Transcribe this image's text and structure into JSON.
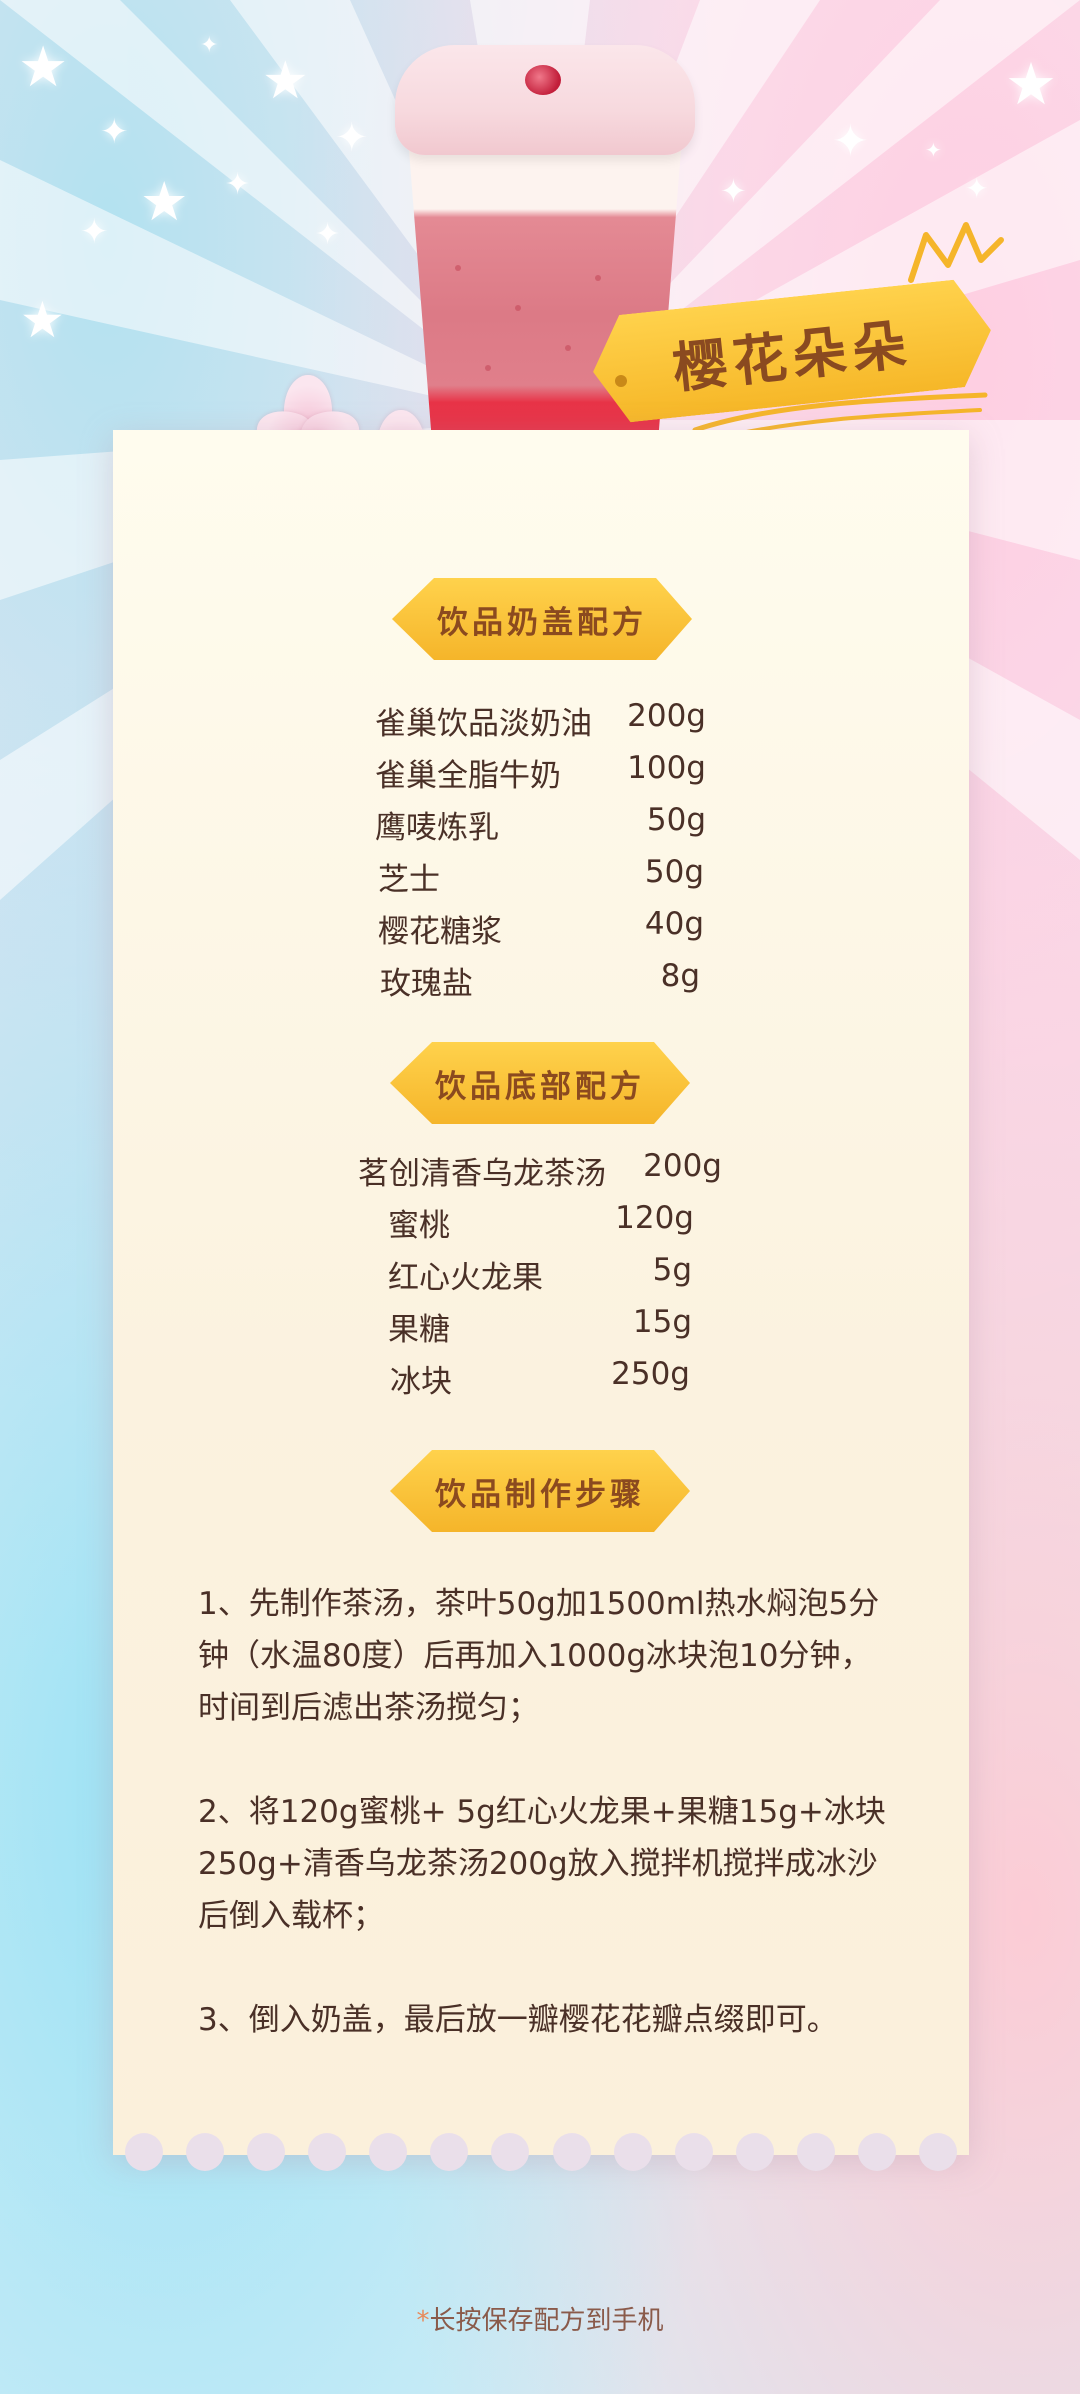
{
  "title": "樱花朵朵",
  "sections": {
    "top": {
      "heading": "饮品奶盖配方",
      "items": [
        {
          "name": "雀巢饮品淡奶油",
          "qty": "200g"
        },
        {
          "name": "雀巢全脂牛奶",
          "qty": "100g"
        },
        {
          "name": "鹰唛炼乳",
          "qty": "50g"
        },
        {
          "name": "芝士",
          "qty": "50g"
        },
        {
          "name": "樱花糖浆",
          "qty": "40g"
        },
        {
          "name": "玫瑰盐",
          "qty": "8g"
        }
      ]
    },
    "base": {
      "heading": "饮品底部配方",
      "items": [
        {
          "name": "茗创清香乌龙茶汤",
          "qty": "200g"
        },
        {
          "name": "蜜桃",
          "qty": "120g"
        },
        {
          "name": "红心火龙果",
          "qty": "5g"
        },
        {
          "name": "果糖",
          "qty": "15g"
        },
        {
          "name": "冰块",
          "qty": "250g"
        }
      ]
    },
    "steps": {
      "heading": "饮品制作步骤",
      "items": [
        "1、先制作茶汤，茶叶50g加1500ml热水焖泡5分钟（水温80度）后再加入1000g冰块泡10分钟，时间到后滤出茶汤搅匀；",
        "2、将120g蜜桃+ 5g红心火龙果+果糖15g+冰块250g+清香乌龙茶汤200g放入搅拌机搅拌成冰沙后倒入载杯；",
        "3、倒入奶盖，最后放一瓣樱花花瓣点缀即可。"
      ]
    }
  },
  "footnote": {
    "mark": "*",
    "text": "长按保存配方到手机"
  },
  "colors": {
    "accent": "#f6b728",
    "text": "#4a3027",
    "label": "#8b4a1f"
  }
}
